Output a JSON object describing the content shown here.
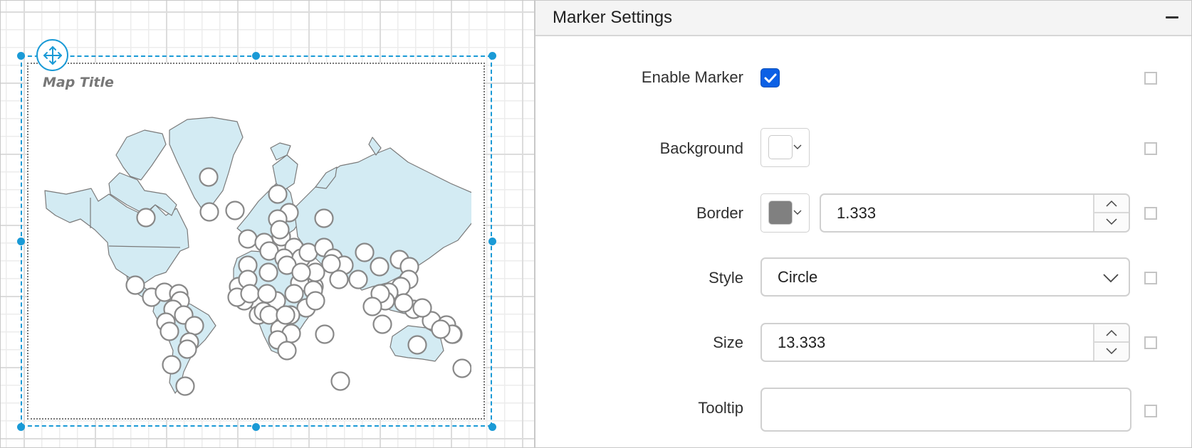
{
  "designer": {
    "map_title": "Map Title",
    "colors": {
      "selection": "#1a9ad6",
      "land_fill": "#d3ebf3",
      "land_border": "#7a7a7a",
      "marker_fill": "#ffffff",
      "marker_border": "#888888"
    }
  },
  "panel": {
    "title": "Marker Settings",
    "collapse_icon": "minus-icon",
    "rows": {
      "enable_marker": {
        "label": "Enable Marker",
        "checked": true
      },
      "background": {
        "label": "Background",
        "color": "#ffffff"
      },
      "border": {
        "label": "Border",
        "color": "#808080",
        "width": "1.333"
      },
      "style": {
        "label": "Style",
        "value": "Circle"
      },
      "size": {
        "label": "Size",
        "value": "13.333"
      },
      "tooltip": {
        "label": "Tooltip",
        "value": ""
      }
    },
    "accent": "#0b60e5"
  }
}
